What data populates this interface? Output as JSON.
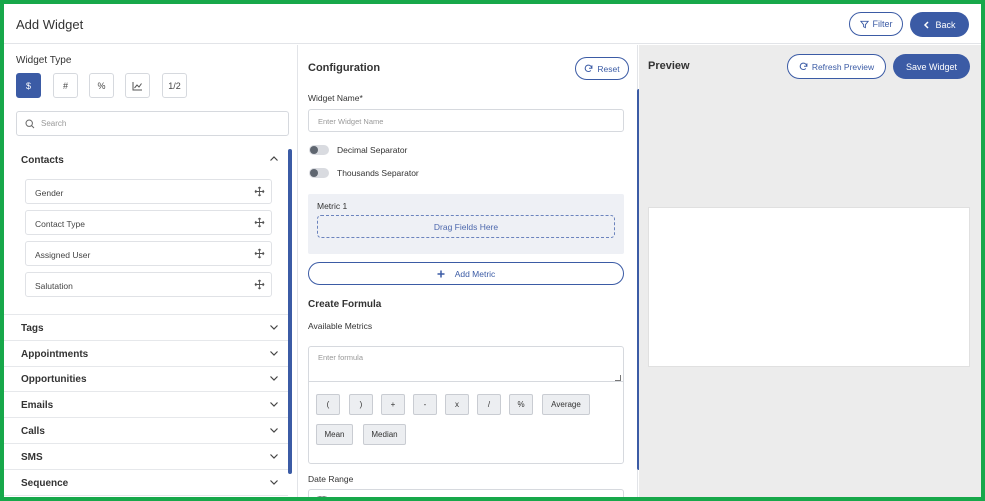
{
  "header": {
    "title": "Add Widget",
    "filter_label": "Filter",
    "back_label": "Back"
  },
  "left": {
    "widget_type_label": "Widget Type",
    "type_buttons": [
      "$",
      "#",
      "%",
      "chart-icon",
      "1/2"
    ],
    "search_placeholder": "Search",
    "categories": [
      {
        "label": "Contacts",
        "expanded": true,
        "fields": [
          "Gender",
          "Contact Type",
          "Assigned User",
          "Salutation"
        ]
      },
      {
        "label": "Tags"
      },
      {
        "label": "Appointments"
      },
      {
        "label": "Opportunities"
      },
      {
        "label": "Emails"
      },
      {
        "label": "Calls"
      },
      {
        "label": "SMS"
      },
      {
        "label": "Sequence"
      }
    ]
  },
  "config": {
    "title": "Configuration",
    "reset_label": "Reset",
    "widget_name_label": "Widget Name*",
    "widget_name_placeholder": "Enter Widget Name",
    "decimal_separator_label": "Decimal Separator",
    "thousands_separator_label": "Thousands Separator",
    "metric_label": "Metric 1",
    "drag_fields_label": "Drag Fields Here",
    "add_metric_label": "Add Metric",
    "create_formula_label": "Create Formula",
    "available_metrics_label": "Available Metrics",
    "formula_placeholder": "Enter formula",
    "operators": [
      "(",
      ")",
      "+",
      "-",
      "x",
      "/",
      "%",
      "Average",
      "Mean",
      "Median"
    ],
    "date_range_label": "Date Range"
  },
  "preview": {
    "title": "Preview",
    "refresh_label": "Refresh Preview",
    "save_label": "Save Widget"
  },
  "colors": {
    "accent": "#3b5ba5",
    "frame": "#17a84a",
    "preview_bg": "#ececec"
  }
}
